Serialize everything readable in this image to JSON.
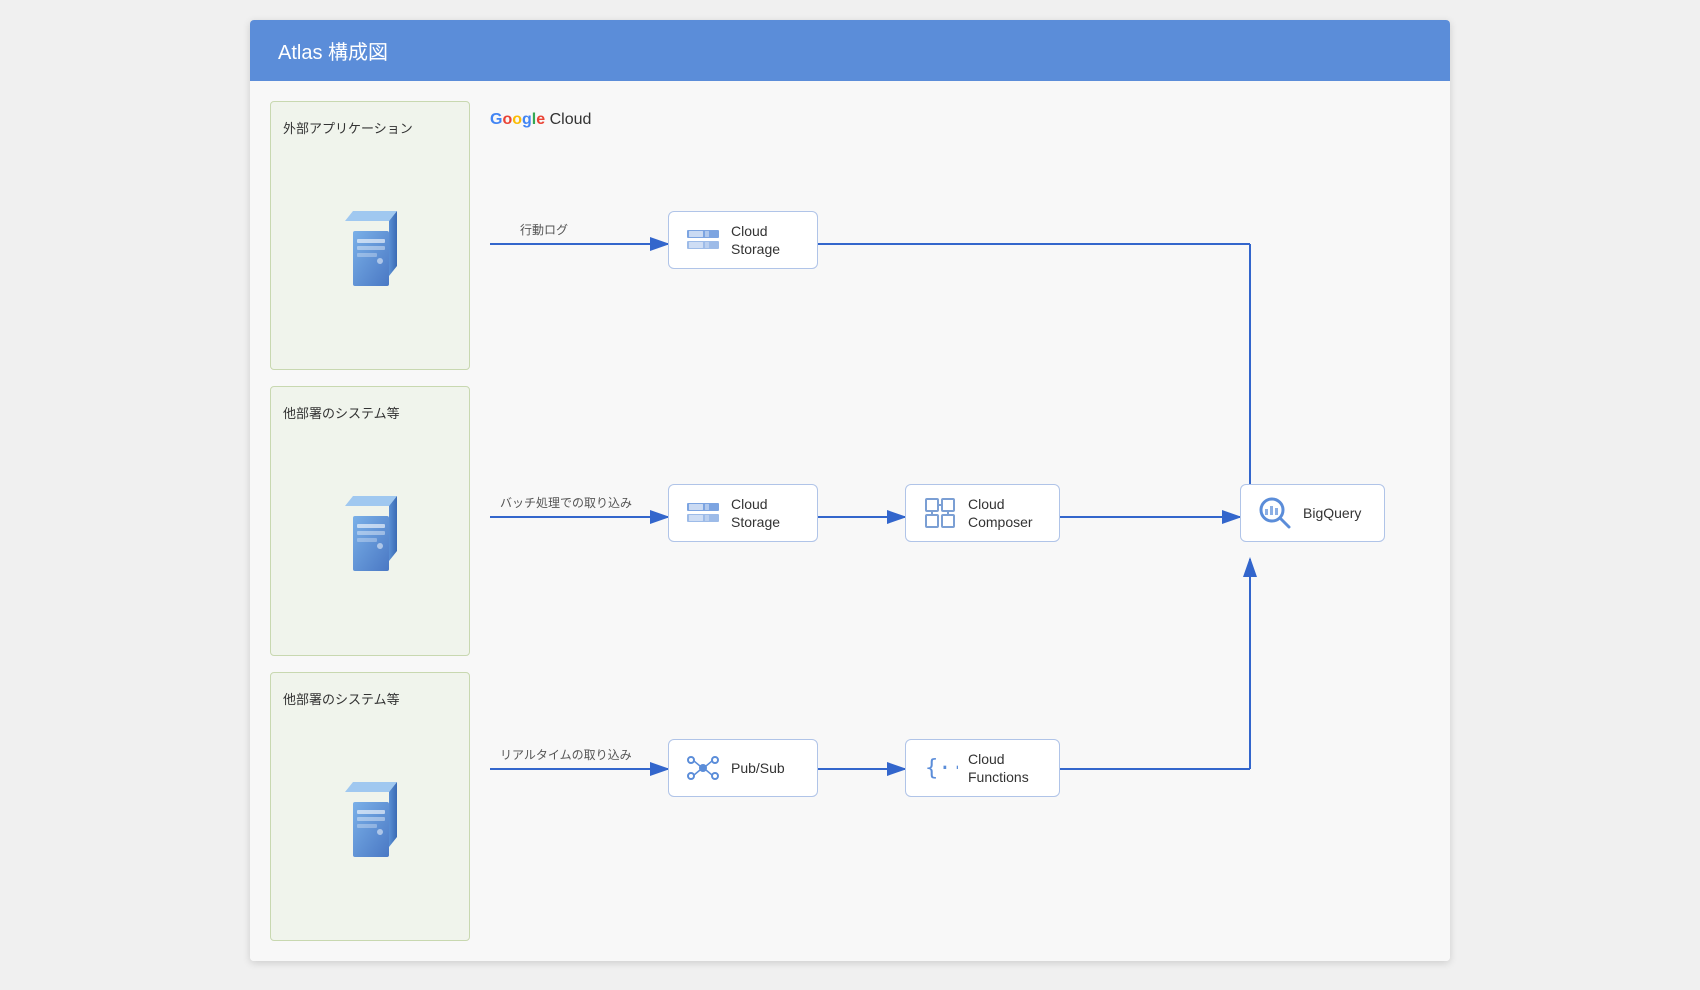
{
  "header": {
    "title": "Atlas 構成図"
  },
  "actors": [
    {
      "id": "actor-1",
      "label": "外部アプリケーション"
    },
    {
      "id": "actor-2",
      "label": "他部署のシステム等"
    },
    {
      "id": "actor-3",
      "label": "他部署のシステム等"
    }
  ],
  "google_cloud_label": "Google Cloud",
  "flows": [
    {
      "arrow_label": "行動ログ",
      "row": 0
    },
    {
      "arrow_label": "バッチ処理での取り込み",
      "row": 1
    },
    {
      "arrow_label": "リアルタイムの取り込み",
      "row": 2
    }
  ],
  "services": {
    "cloud_storage_1": "Cloud\nStorage",
    "cloud_storage_2": "Cloud\nStorage",
    "cloud_composer": "Cloud\nComposer",
    "bigquery": "BigQuery",
    "pubsub": "Pub/Sub",
    "cloud_functions": "Cloud\nFunctions"
  }
}
